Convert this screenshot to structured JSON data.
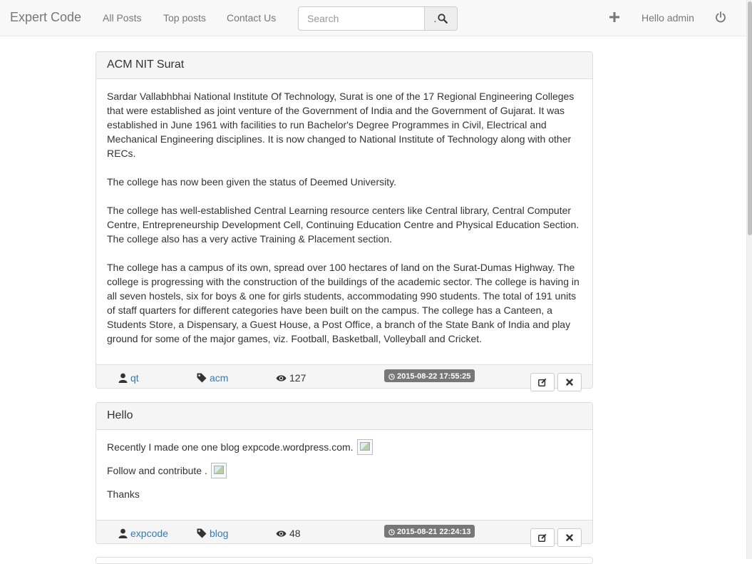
{
  "navbar": {
    "brand": "Expert Code",
    "links": [
      "All Posts",
      "Top posts",
      "Contact Us"
    ],
    "search_placeholder": "Search",
    "search_button_dot": ".",
    "greeting": "Hello admin"
  },
  "posts": [
    {
      "title": "ACM NIT Surat",
      "paragraphs": [
        "Sardar Vallabhbhai National Institute Of Technology, Surat is one of the 17 Regional Engineering Colleges that were established as joint venture of the Government of India and the Government of Gujarat. It was established in June 1961 with facilities to run Bachelor's Degree Programmes in Civil, Electrical and Mechanical Engineering disciplines. It is now changed to National Institute of Technology along with other RECs.",
        "The college has now been given the status of Deemed University.",
        "The college has well-established Central Learning resource centers like Central library, Central Computer Centre, Entrepreneurship Development Cell, Continuing Education Centre and Physical Education Section. The college also has a very active Training & Placement section.",
        "The college has a campus of its own, spread over 100 hectares of land on the Surat-Dumas Highway. The college is progressing with the construction of the buildings of the academic sector. The college is having in all seven hostels, six for boys & one for girls students, accommodating 990 students. The total of 191 units of staff quarters for different categories have been built on the campus. The college has a Canteen, a Students Store, a Dispensary, a Guest House, a Post Office, a branch of the State Bank of India and play ground for some of the major games, viz. Football, Basketball, Volleyball and Cricket."
      ],
      "author": "qt",
      "tag": "acm",
      "views": "127",
      "date": "2015-08-22 17:55:25"
    },
    {
      "title": "Hello",
      "lines": [
        "Recently I made one one blog expcode.wordpress.com.",
        "Follow and contribute .",
        "Thanks"
      ],
      "author": "expcode",
      "tag": "blog",
      "views": "48",
      "date": "2015-08-21 22:24:13"
    }
  ],
  "icons": {
    "add": "plus-icon",
    "logout": "power-icon",
    "search": "search-icon",
    "author": "user-icon",
    "tag": "tag-icon",
    "views": "eye-icon",
    "date": "clock-icon",
    "edit": "edit-icon",
    "delete": "close-icon"
  },
  "colors": {
    "navbar_bg": "#f8f8f8",
    "link": "#337ab7",
    "label_bg": "#777777",
    "panel_heading_bg": "#f5f5f5"
  }
}
